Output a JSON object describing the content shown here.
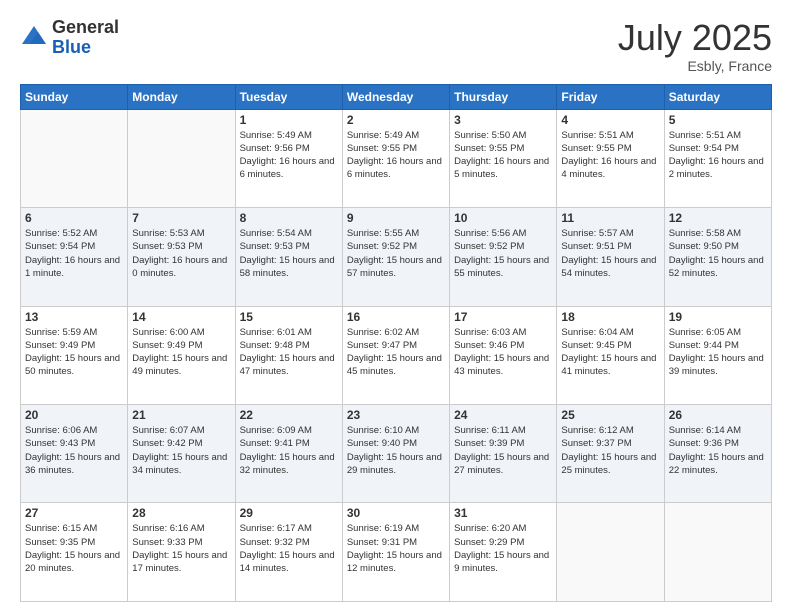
{
  "header": {
    "logo_general": "General",
    "logo_blue": "Blue",
    "month_year": "July 2025",
    "location": "Esbly, France"
  },
  "weekdays": [
    "Sunday",
    "Monday",
    "Tuesday",
    "Wednesday",
    "Thursday",
    "Friday",
    "Saturday"
  ],
  "weeks": [
    [
      {
        "day": "",
        "sunrise": "",
        "sunset": "",
        "daylight": ""
      },
      {
        "day": "",
        "sunrise": "",
        "sunset": "",
        "daylight": ""
      },
      {
        "day": "1",
        "sunrise": "Sunrise: 5:49 AM",
        "sunset": "Sunset: 9:56 PM",
        "daylight": "Daylight: 16 hours and 6 minutes."
      },
      {
        "day": "2",
        "sunrise": "Sunrise: 5:49 AM",
        "sunset": "Sunset: 9:55 PM",
        "daylight": "Daylight: 16 hours and 6 minutes."
      },
      {
        "day": "3",
        "sunrise": "Sunrise: 5:50 AM",
        "sunset": "Sunset: 9:55 PM",
        "daylight": "Daylight: 16 hours and 5 minutes."
      },
      {
        "day": "4",
        "sunrise": "Sunrise: 5:51 AM",
        "sunset": "Sunset: 9:55 PM",
        "daylight": "Daylight: 16 hours and 4 minutes."
      },
      {
        "day": "5",
        "sunrise": "Sunrise: 5:51 AM",
        "sunset": "Sunset: 9:54 PM",
        "daylight": "Daylight: 16 hours and 2 minutes."
      }
    ],
    [
      {
        "day": "6",
        "sunrise": "Sunrise: 5:52 AM",
        "sunset": "Sunset: 9:54 PM",
        "daylight": "Daylight: 16 hours and 1 minute."
      },
      {
        "day": "7",
        "sunrise": "Sunrise: 5:53 AM",
        "sunset": "Sunset: 9:53 PM",
        "daylight": "Daylight: 16 hours and 0 minutes."
      },
      {
        "day": "8",
        "sunrise": "Sunrise: 5:54 AM",
        "sunset": "Sunset: 9:53 PM",
        "daylight": "Daylight: 15 hours and 58 minutes."
      },
      {
        "day": "9",
        "sunrise": "Sunrise: 5:55 AM",
        "sunset": "Sunset: 9:52 PM",
        "daylight": "Daylight: 15 hours and 57 minutes."
      },
      {
        "day": "10",
        "sunrise": "Sunrise: 5:56 AM",
        "sunset": "Sunset: 9:52 PM",
        "daylight": "Daylight: 15 hours and 55 minutes."
      },
      {
        "day": "11",
        "sunrise": "Sunrise: 5:57 AM",
        "sunset": "Sunset: 9:51 PM",
        "daylight": "Daylight: 15 hours and 54 minutes."
      },
      {
        "day": "12",
        "sunrise": "Sunrise: 5:58 AM",
        "sunset": "Sunset: 9:50 PM",
        "daylight": "Daylight: 15 hours and 52 minutes."
      }
    ],
    [
      {
        "day": "13",
        "sunrise": "Sunrise: 5:59 AM",
        "sunset": "Sunset: 9:49 PM",
        "daylight": "Daylight: 15 hours and 50 minutes."
      },
      {
        "day": "14",
        "sunrise": "Sunrise: 6:00 AM",
        "sunset": "Sunset: 9:49 PM",
        "daylight": "Daylight: 15 hours and 49 minutes."
      },
      {
        "day": "15",
        "sunrise": "Sunrise: 6:01 AM",
        "sunset": "Sunset: 9:48 PM",
        "daylight": "Daylight: 15 hours and 47 minutes."
      },
      {
        "day": "16",
        "sunrise": "Sunrise: 6:02 AM",
        "sunset": "Sunset: 9:47 PM",
        "daylight": "Daylight: 15 hours and 45 minutes."
      },
      {
        "day": "17",
        "sunrise": "Sunrise: 6:03 AM",
        "sunset": "Sunset: 9:46 PM",
        "daylight": "Daylight: 15 hours and 43 minutes."
      },
      {
        "day": "18",
        "sunrise": "Sunrise: 6:04 AM",
        "sunset": "Sunset: 9:45 PM",
        "daylight": "Daylight: 15 hours and 41 minutes."
      },
      {
        "day": "19",
        "sunrise": "Sunrise: 6:05 AM",
        "sunset": "Sunset: 9:44 PM",
        "daylight": "Daylight: 15 hours and 39 minutes."
      }
    ],
    [
      {
        "day": "20",
        "sunrise": "Sunrise: 6:06 AM",
        "sunset": "Sunset: 9:43 PM",
        "daylight": "Daylight: 15 hours and 36 minutes."
      },
      {
        "day": "21",
        "sunrise": "Sunrise: 6:07 AM",
        "sunset": "Sunset: 9:42 PM",
        "daylight": "Daylight: 15 hours and 34 minutes."
      },
      {
        "day": "22",
        "sunrise": "Sunrise: 6:09 AM",
        "sunset": "Sunset: 9:41 PM",
        "daylight": "Daylight: 15 hours and 32 minutes."
      },
      {
        "day": "23",
        "sunrise": "Sunrise: 6:10 AM",
        "sunset": "Sunset: 9:40 PM",
        "daylight": "Daylight: 15 hours and 29 minutes."
      },
      {
        "day": "24",
        "sunrise": "Sunrise: 6:11 AM",
        "sunset": "Sunset: 9:39 PM",
        "daylight": "Daylight: 15 hours and 27 minutes."
      },
      {
        "day": "25",
        "sunrise": "Sunrise: 6:12 AM",
        "sunset": "Sunset: 9:37 PM",
        "daylight": "Daylight: 15 hours and 25 minutes."
      },
      {
        "day": "26",
        "sunrise": "Sunrise: 6:14 AM",
        "sunset": "Sunset: 9:36 PM",
        "daylight": "Daylight: 15 hours and 22 minutes."
      }
    ],
    [
      {
        "day": "27",
        "sunrise": "Sunrise: 6:15 AM",
        "sunset": "Sunset: 9:35 PM",
        "daylight": "Daylight: 15 hours and 20 minutes."
      },
      {
        "day": "28",
        "sunrise": "Sunrise: 6:16 AM",
        "sunset": "Sunset: 9:33 PM",
        "daylight": "Daylight: 15 hours and 17 minutes."
      },
      {
        "day": "29",
        "sunrise": "Sunrise: 6:17 AM",
        "sunset": "Sunset: 9:32 PM",
        "daylight": "Daylight: 15 hours and 14 minutes."
      },
      {
        "day": "30",
        "sunrise": "Sunrise: 6:19 AM",
        "sunset": "Sunset: 9:31 PM",
        "daylight": "Daylight: 15 hours and 12 minutes."
      },
      {
        "day": "31",
        "sunrise": "Sunrise: 6:20 AM",
        "sunset": "Sunset: 9:29 PM",
        "daylight": "Daylight: 15 hours and 9 minutes."
      },
      {
        "day": "",
        "sunrise": "",
        "sunset": "",
        "daylight": ""
      },
      {
        "day": "",
        "sunrise": "",
        "sunset": "",
        "daylight": ""
      }
    ]
  ]
}
